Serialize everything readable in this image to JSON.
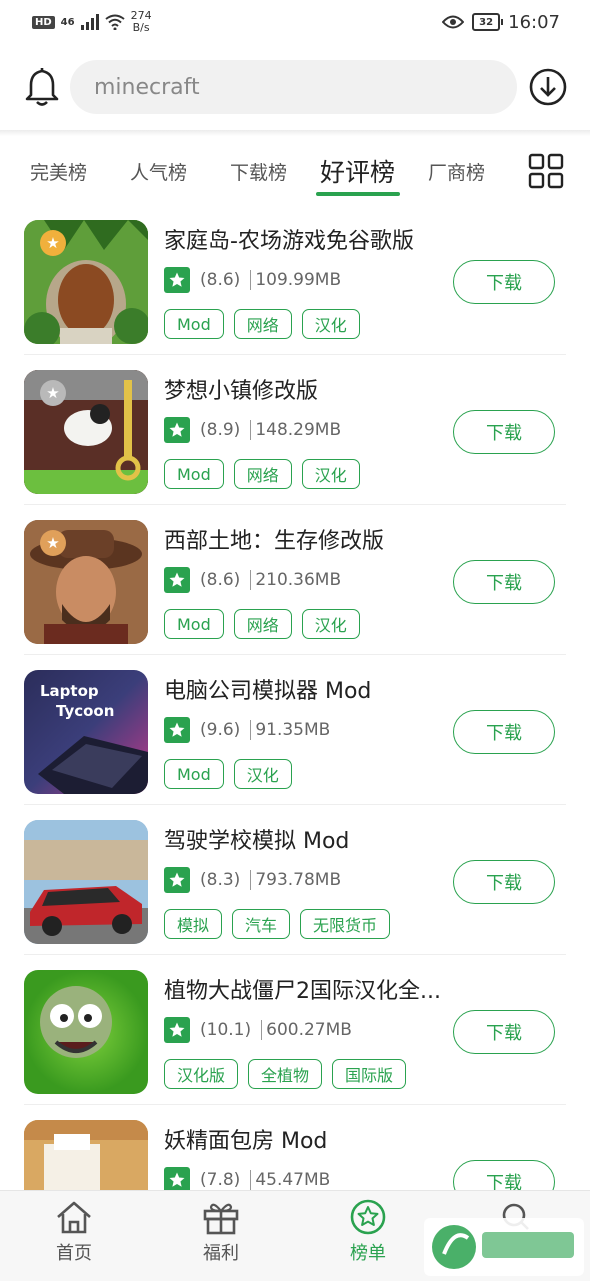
{
  "status_bar": {
    "hd": "HD",
    "signal": "46",
    "speed_value": "274",
    "speed_unit": "B/s",
    "battery": "32",
    "time": "16:07"
  },
  "search": {
    "placeholder": "minecraft"
  },
  "tabs": [
    {
      "label": "完美榜",
      "active": false
    },
    {
      "label": "人气榜",
      "active": false
    },
    {
      "label": "下载榜",
      "active": false
    },
    {
      "label": "好评榜",
      "active": true
    },
    {
      "label": "厂商榜",
      "active": false
    }
  ],
  "apps": [
    {
      "title": "家庭岛-农场游戏免谷歌版",
      "rating": "(8.6)",
      "size": "109.99MB",
      "tags": [
        "Mod",
        "网络",
        "汉化"
      ],
      "button": "下载"
    },
    {
      "title": "梦想小镇修改版",
      "rating": "(8.9)",
      "size": "148.29MB",
      "tags": [
        "Mod",
        "网络",
        "汉化"
      ],
      "button": "下载"
    },
    {
      "title": "西部土地：生存修改版",
      "rating": "(8.6)",
      "size": "210.36MB",
      "tags": [
        "Mod",
        "网络",
        "汉化"
      ],
      "button": "下载"
    },
    {
      "title": "电脑公司模拟器 Mod",
      "rating": "(9.6)",
      "size": "91.35MB",
      "tags": [
        "Mod",
        "汉化"
      ],
      "button": "下载",
      "thumb_text_1": "Laptop",
      "thumb_text_2": "Tycoon"
    },
    {
      "title": "驾驶学校模拟 Mod",
      "rating": "(8.3)",
      "size": "793.78MB",
      "tags": [
        "模拟",
        "汽车",
        "无限货币"
      ],
      "button": "下载"
    },
    {
      "title": "植物大战僵尸2国际汉化全...",
      "rating": "(10.1)",
      "size": "600.27MB",
      "tags": [
        "汉化版",
        "全植物",
        "国际版"
      ],
      "button": "下载"
    },
    {
      "title": "妖精面包房 Mod",
      "rating": "(7.8)",
      "size": "45.47MB",
      "tags": [],
      "button": "下载"
    }
  ],
  "bottom_nav": [
    {
      "label": "首页",
      "active": false
    },
    {
      "label": "福利",
      "active": false
    },
    {
      "label": "榜单",
      "active": true
    },
    {
      "label": "",
      "active": false
    }
  ],
  "colors": {
    "accent": "#2aa24f"
  }
}
